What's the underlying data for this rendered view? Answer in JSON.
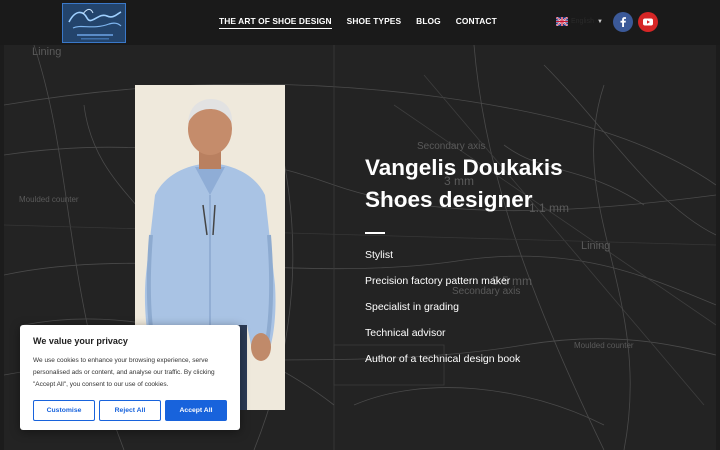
{
  "header": {
    "nav": [
      {
        "label": "THE ART OF SHOE DESIGN",
        "active": true
      },
      {
        "label": "SHOE TYPES",
        "active": false
      },
      {
        "label": "BLOG",
        "active": false
      },
      {
        "label": "CONTACT",
        "active": false
      }
    ],
    "language": {
      "label": "English",
      "icon": "uk-flag-icon"
    },
    "social": [
      {
        "name": "facebook",
        "glyph": "f",
        "color": "#3b5998"
      },
      {
        "name": "youtube",
        "glyph": "▶",
        "color": "#d62626"
      }
    ]
  },
  "background_text": [
    "Lining",
    "Secondary axis",
    "Moulded counter",
    "3 mm",
    "1.1 mm",
    "5.5 mm",
    "Lining",
    "Secondary axis",
    "Moulded counter"
  ],
  "hero": {
    "name_line1": "Vangelis Doukakis",
    "name_line2": "Shoes designer",
    "roles": [
      "Stylist",
      "Precision factory pattern maker",
      "Specialist in grading",
      "Technical advisor",
      "Author of a technical design book"
    ]
  },
  "cookie": {
    "title": "We value your privacy",
    "text": "We use cookies to enhance your browsing experience, serve personalised ads or content, and analyse our traffic. By clicking \"Accept All\", you consent to our use of cookies.",
    "customise": "Customise",
    "reject": "Reject All",
    "accept": "Accept All"
  },
  "colors": {
    "accent": "#1863dc",
    "header_bg": "#1a1a1a",
    "hero_bg": "#222222"
  }
}
